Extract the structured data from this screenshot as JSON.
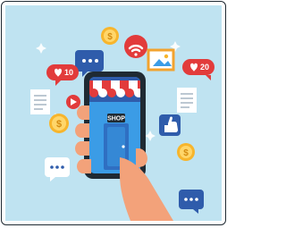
{
  "illustration": {
    "shop_sign": "SHOP",
    "heart_counts": {
      "left": "10",
      "right": "20"
    },
    "currency_symbol": "$",
    "colors": {
      "background": "#bfe3f1",
      "phone_body": "#1f2a33",
      "screen": "#3b9ce6",
      "awning_red": "#e23b3b",
      "awning_white": "#ffffff",
      "coin_gold": "#f7b52c",
      "hand": "#f3a27a"
    },
    "icons": [
      "speech-bubble-icon",
      "dollar-coin-icon",
      "wifi-icon",
      "image-icon",
      "heart-badge-icon",
      "document-icon",
      "play-icon",
      "thumbs-up-icon",
      "sparkle-icon"
    ]
  }
}
